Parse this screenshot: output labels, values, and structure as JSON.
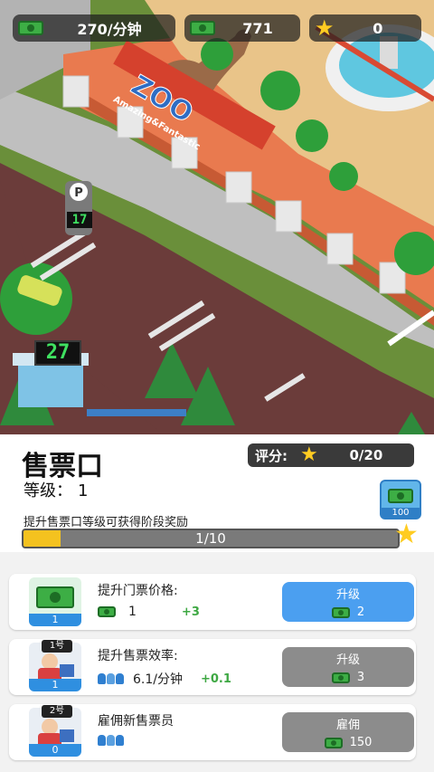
{
  "hud": {
    "income_rate": "270/分钟",
    "money": "771",
    "stars": "0"
  },
  "scene": {
    "park_sign_main": "ZOO",
    "park_sign_sub": "Amazing&Fantastic",
    "parking_count_top": "17",
    "parking_count_booth": "27"
  },
  "booth": {
    "name": "售票口",
    "level_label": "等级：",
    "level_value": "1",
    "rating_label": "评分:",
    "rating_value": "0/20",
    "upgrade_hint": "提升售票口等级可获得阶段奖励",
    "progress_text": "1/10",
    "progress_fraction": 0.1,
    "reward_value": "100"
  },
  "cards": [
    {
      "title": "提升门票价格:",
      "level": "1",
      "value": "1",
      "increment": "+3",
      "button_label": "升级",
      "button_cost": "2",
      "button_color": "blue"
    },
    {
      "title": "提升售票效率:",
      "tag": "1号",
      "level": "1",
      "value": "6.1/分钟",
      "increment": "+0.1",
      "button_label": "升级",
      "button_cost": "3",
      "button_color": "gray"
    },
    {
      "title": "雇佣新售票员",
      "tag": "2号",
      "level": "0",
      "button_label": "雇佣",
      "button_cost": "150",
      "button_color": "gray"
    }
  ]
}
